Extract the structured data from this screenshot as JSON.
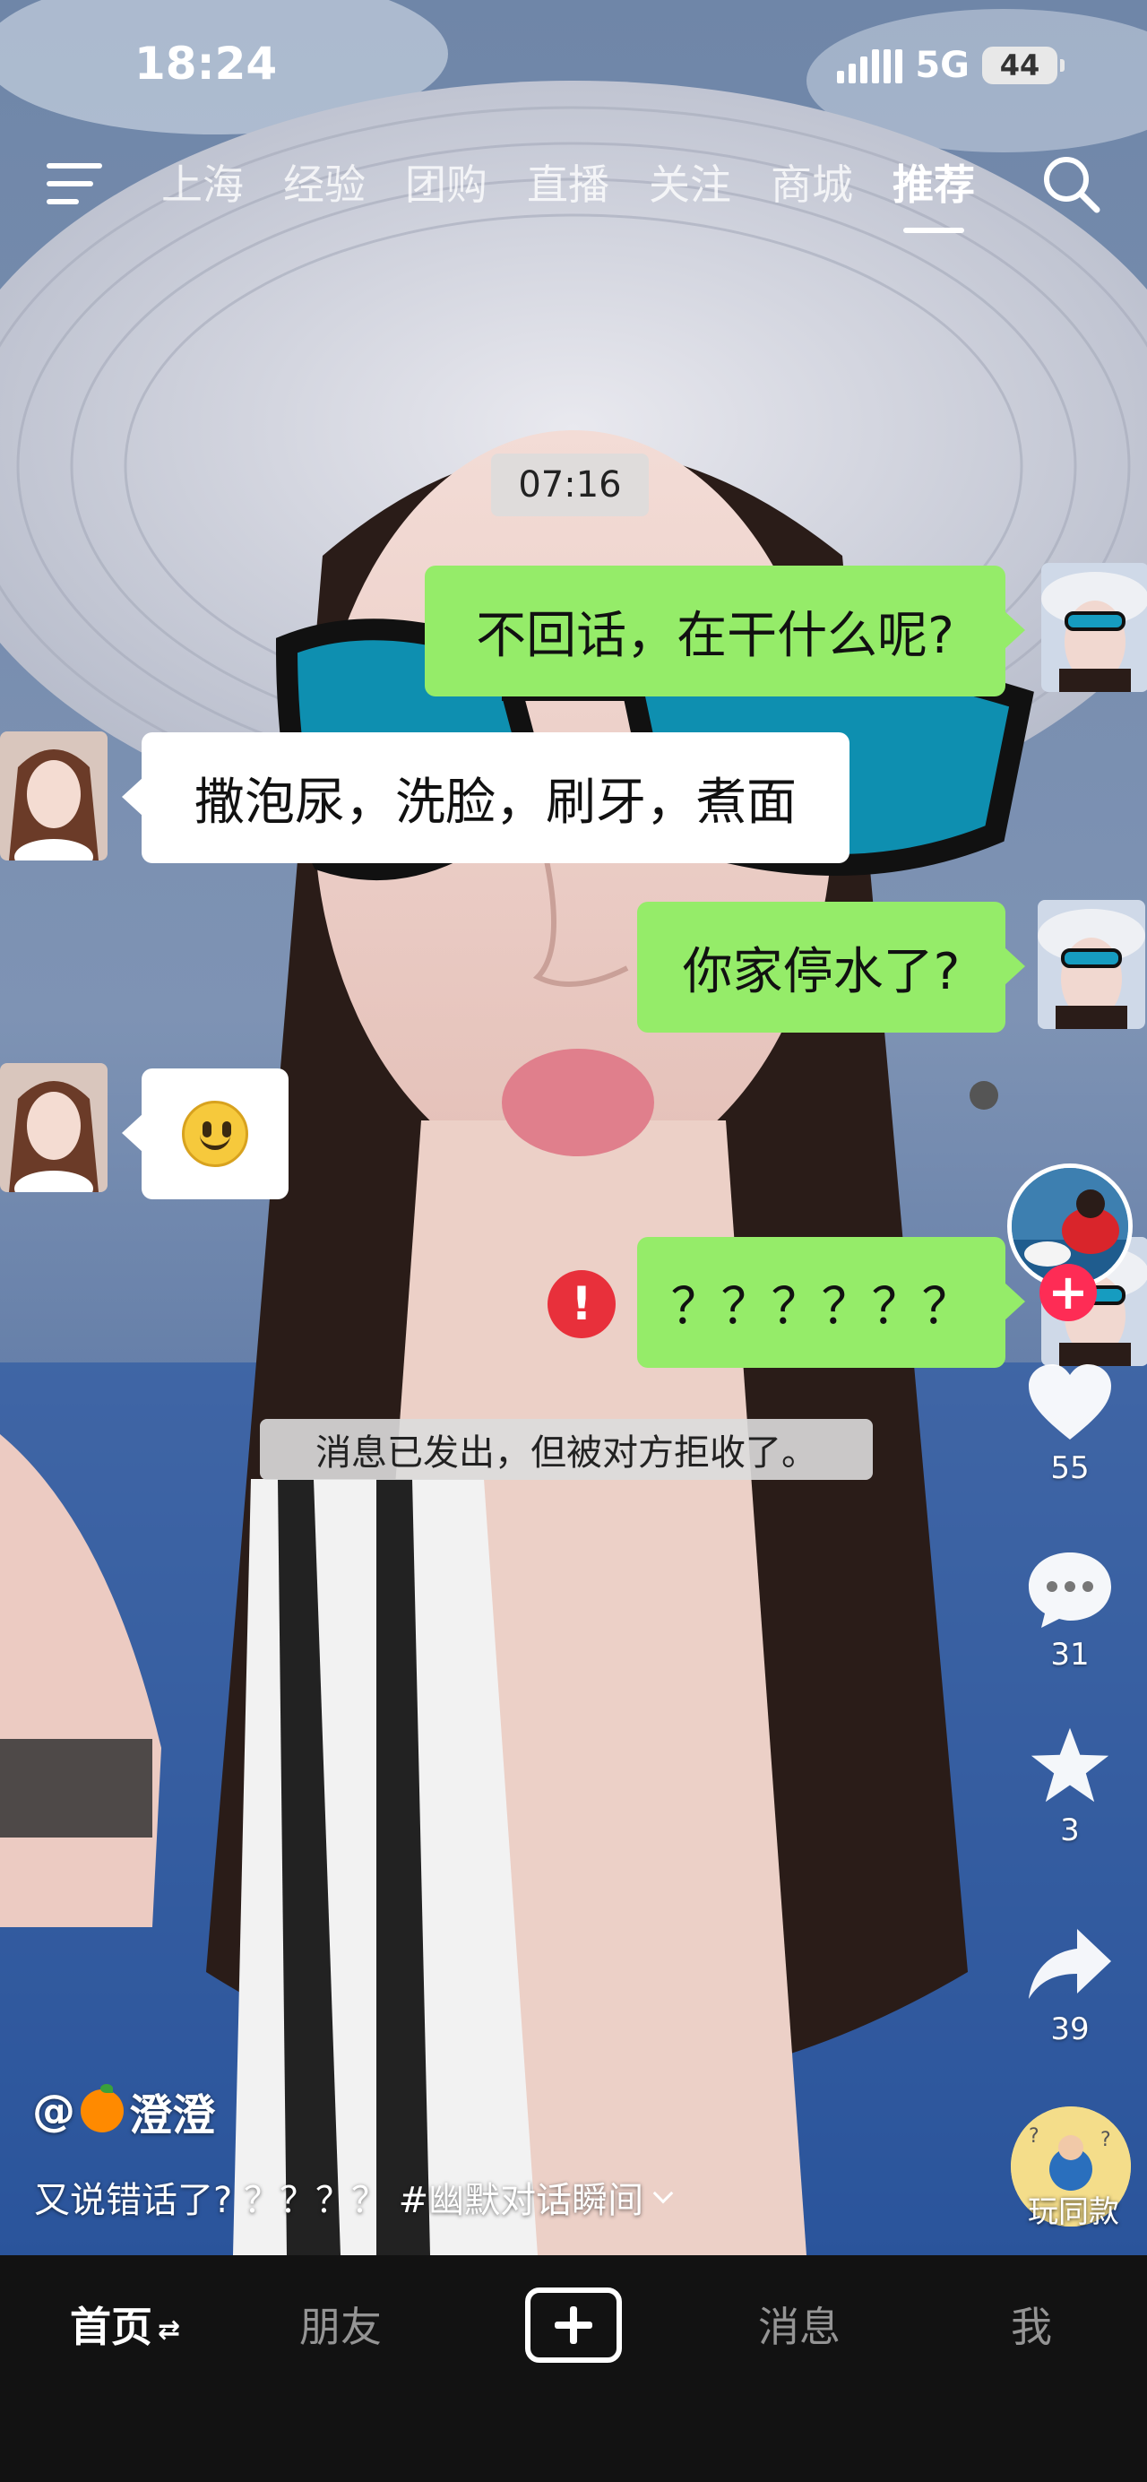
{
  "status": {
    "time": "18:24",
    "network": "5G",
    "battery": "44"
  },
  "top_nav": {
    "tabs": [
      {
        "label": "上海"
      },
      {
        "label": "经验"
      },
      {
        "label": "团购"
      },
      {
        "label": "直播"
      },
      {
        "label": "关注"
      },
      {
        "label": "商城"
      },
      {
        "label": "推荐",
        "active": true
      }
    ]
  },
  "chat": {
    "timestamp": "07:16",
    "messages": [
      {
        "side": "right",
        "text": "不回话，在干什么呢?"
      },
      {
        "side": "left",
        "text": "撒泡尿，洗脸，刷牙，煮面"
      },
      {
        "side": "right",
        "text": "你家停水了?"
      },
      {
        "side": "left",
        "emoji": "smiley-icon"
      },
      {
        "side": "right",
        "text": "？？？？？？",
        "failed": true
      }
    ],
    "error_mark": "!",
    "rejected_note": "消息已发出，但被对方拒收了。"
  },
  "actions": {
    "follow": "+",
    "likes": "55",
    "comments": "31",
    "favorites": "3",
    "shares": "39",
    "play_same": "玩同款"
  },
  "caption": {
    "author": "@",
    "author_name": "澄澄",
    "text": "又说错话了? ？？？？ #幽默对话瞬间"
  },
  "bottom_nav": {
    "home": "首页",
    "friends": "朋友",
    "messages": "消息",
    "me": "我"
  },
  "colors": {
    "accent": "#fe2c55",
    "bubble_green": "#95ec69",
    "bubble_white": "#ffffff",
    "nav_bg": "#121212"
  }
}
